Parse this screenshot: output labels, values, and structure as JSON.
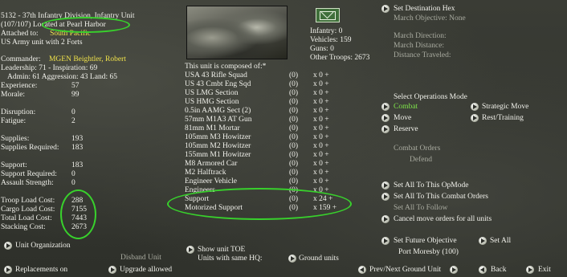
{
  "header": {
    "unit_title": "5132 - 37th Infantry Division, Infantry Unit",
    "strength": "(107/107)",
    "located_label": "Located at",
    "location": "Pearl Harbor",
    "attached_label": "Attached to:",
    "attached_to": "South Pacific",
    "unit_type": "US Army unit with 2 Forts"
  },
  "commander": {
    "label": "Commander:",
    "name": "MGEN Beightler, Robert",
    "ratings_line1": "Leadership: 71 - Inspiration: 69",
    "ratings_line2": "Admin: 61  Aggression: 43  Land: 65"
  },
  "stats": [
    {
      "label": "Experience:",
      "value": "57"
    },
    {
      "label": "Morale:",
      "value": "99"
    },
    {
      "label": "",
      "value": ""
    },
    {
      "label": "Disruption:",
      "value": "0"
    },
    {
      "label": "Fatigue:",
      "value": "2"
    },
    {
      "label": "",
      "value": ""
    },
    {
      "label": "Supplies:",
      "value": "193"
    },
    {
      "label": "Supplies Required:",
      "value": "183"
    },
    {
      "label": "",
      "value": ""
    },
    {
      "label": "Support:",
      "value": "183"
    },
    {
      "label": "Support Required:",
      "value": "0"
    },
    {
      "label": "Assault Strength:",
      "value": "0"
    },
    {
      "label": "",
      "value": ""
    },
    {
      "label": "Troop Load Cost:",
      "value": "288"
    },
    {
      "label": "Cargo Load Cost:",
      "value": "7155"
    },
    {
      "label": "Total Load Cost:",
      "value": "7443"
    },
    {
      "label": "Stacking Cost:",
      "value": "2673"
    }
  ],
  "counts": {
    "infantry": "Infantry: 0",
    "vehicles": "Vehicles: 159",
    "guns": "Guns: 0",
    "other": "Other Troops: 2673"
  },
  "composition": {
    "heading": "This unit is composed of:*",
    "rows": [
      {
        "name": "USA 43 Rifle Squad",
        "qty": "(0)",
        "x": "x 0 +"
      },
      {
        "name": "US 43 Cmbt Eng Sqd",
        "qty": "(0)",
        "x": "x 0 +"
      },
      {
        "name": "US LMG Section",
        "qty": "(0)",
        "x": "x 0 +"
      },
      {
        "name": "US HMG Section",
        "qty": "(0)",
        "x": "x 0 +"
      },
      {
        "name": "0.5in AAMG Sect (2)",
        "qty": "(0)",
        "x": "x 0 +"
      },
      {
        "name": "57mm M1A3 AT Gun",
        "qty": "(0)",
        "x": "x 0 +"
      },
      {
        "name": "81mm M1 Mortar",
        "qty": "(0)",
        "x": "x 0 +"
      },
      {
        "name": "105mm M3 Howitzer",
        "qty": "(0)",
        "x": "x 0 +"
      },
      {
        "name": "105mm M2 Howitzer",
        "qty": "(0)",
        "x": "x 0 +"
      },
      {
        "name": "155mm M1 Howitzer",
        "qty": "(0)",
        "x": "x 0 +"
      },
      {
        "name": "M8 Armored Car",
        "qty": "(0)",
        "x": "x 0 +"
      },
      {
        "name": "M2 Halftrack",
        "qty": "(0)",
        "x": "x 0 +"
      },
      {
        "name": "Engineer Vehicle",
        "qty": "(0)",
        "x": "x 0 +"
      },
      {
        "name": "Engineers",
        "qty": "(0)",
        "x": "x 0 +"
      },
      {
        "name": "Support",
        "qty": "(0)",
        "x": "x 24 +"
      },
      {
        "name": "Motorized Support",
        "qty": "(0)",
        "x": "x 159 +"
      }
    ]
  },
  "march": {
    "set_destination": "Set Destination Hex",
    "objective": "March Objective: None",
    "direction": "March Direction:",
    "distance": "March Distance:",
    "traveled": "Distance Traveled:"
  },
  "ops": {
    "heading": "Select Operations Mode",
    "combat": "Combat",
    "move": "Move",
    "reserve": "Reserve",
    "strategic": "Strategic Move",
    "rest": "Rest/Training",
    "combat_orders": "Combat Orders",
    "defend": "Defend"
  },
  "actions": {
    "set_all_opmode": "Set All To This OpMode",
    "set_all_orders": "Set All To This Combat Orders",
    "set_all_follow": "Set All To Follow",
    "cancel_move": "Cancel move orders for all units",
    "future_objective": "Set Future Objective",
    "set_all": "Set All",
    "objective_value": "Port Moresby (100)"
  },
  "bottom": {
    "unit_org": "Unit Organization",
    "disband": "Disband Unit",
    "show_toe": "Show unit TOE",
    "same_hq": "Units with same HQ:",
    "ground_units": "Ground units",
    "replacements": "Replacements on",
    "upgrade": "Upgrade allowed",
    "prev_next": "Prev/Next Ground Unit",
    "back": "Back",
    "exit": "Exit"
  }
}
